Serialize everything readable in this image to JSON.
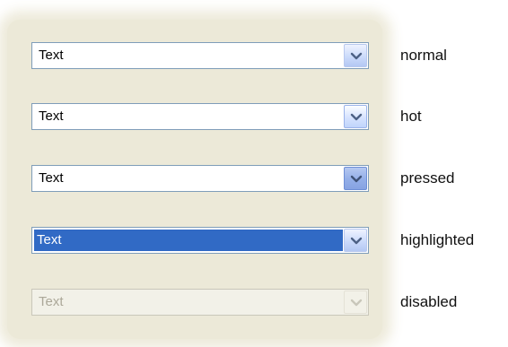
{
  "combos": [
    {
      "text": "Text",
      "state": "normal"
    },
    {
      "text": "Text",
      "state": "hot"
    },
    {
      "text": "Text",
      "state": "pressed"
    },
    {
      "text": "Text",
      "state": "highlighted"
    },
    {
      "text": "Text",
      "state": "disabled"
    }
  ],
  "icons": {
    "dropdown": "chevron-down-icon"
  },
  "colors": {
    "panel": "#ece9d8",
    "border": "#7f9db9",
    "selection": "#316ac5",
    "disabled_text": "#aca899"
  }
}
